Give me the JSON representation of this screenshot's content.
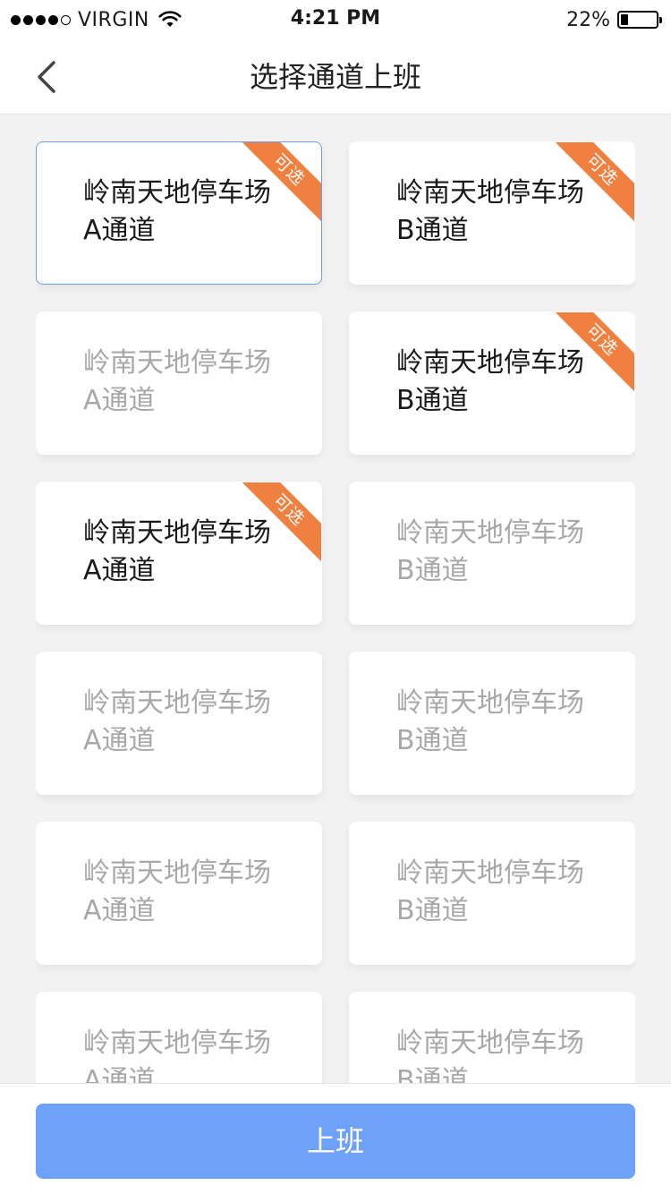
{
  "status_bar": {
    "carrier": "VIRGIN",
    "time": "4:21 PM",
    "battery_percent": "22%",
    "battery_level": 0.22
  },
  "nav": {
    "title": "选择通道上班",
    "back_icon": "chevron-left-icon"
  },
  "badge_label": "可选",
  "cards": [
    {
      "line1": "岭南天地停车场",
      "line2": "A通道",
      "state": "selected",
      "available": true
    },
    {
      "line1": "岭南天地停车场",
      "line2": "B通道",
      "state": "normal",
      "available": true
    },
    {
      "line1": "岭南天地停车场",
      "line2": "A通道",
      "state": "disabled",
      "available": false
    },
    {
      "line1": "岭南天地停车场",
      "line2": "B通道",
      "state": "normal",
      "available": true
    },
    {
      "line1": "岭南天地停车场",
      "line2": "A通道",
      "state": "normal",
      "available": true
    },
    {
      "line1": "岭南天地停车场",
      "line2": "B通道",
      "state": "disabled",
      "available": false
    },
    {
      "line1": "岭南天地停车场",
      "line2": "A通道",
      "state": "disabled",
      "available": false
    },
    {
      "line1": "岭南天地停车场",
      "line2": "B通道",
      "state": "disabled",
      "available": false
    },
    {
      "line1": "岭南天地停车场",
      "line2": "A通道",
      "state": "disabled",
      "available": false
    },
    {
      "line1": "岭南天地停车场",
      "line2": "B通道",
      "state": "disabled",
      "available": false
    },
    {
      "line1": "岭南天地停车场",
      "line2": "A通道",
      "state": "disabled",
      "available": false
    },
    {
      "line1": "岭南天地停车场",
      "line2": "B通道",
      "state": "disabled",
      "available": false
    }
  ],
  "footer": {
    "submit_label": "上班"
  },
  "colors": {
    "accent": "#6ea2f9",
    "selected_border": "#6b9ef5",
    "badge": "#f08040",
    "disabled_text": "#a8a8a8",
    "background": "#f2f2f2"
  }
}
